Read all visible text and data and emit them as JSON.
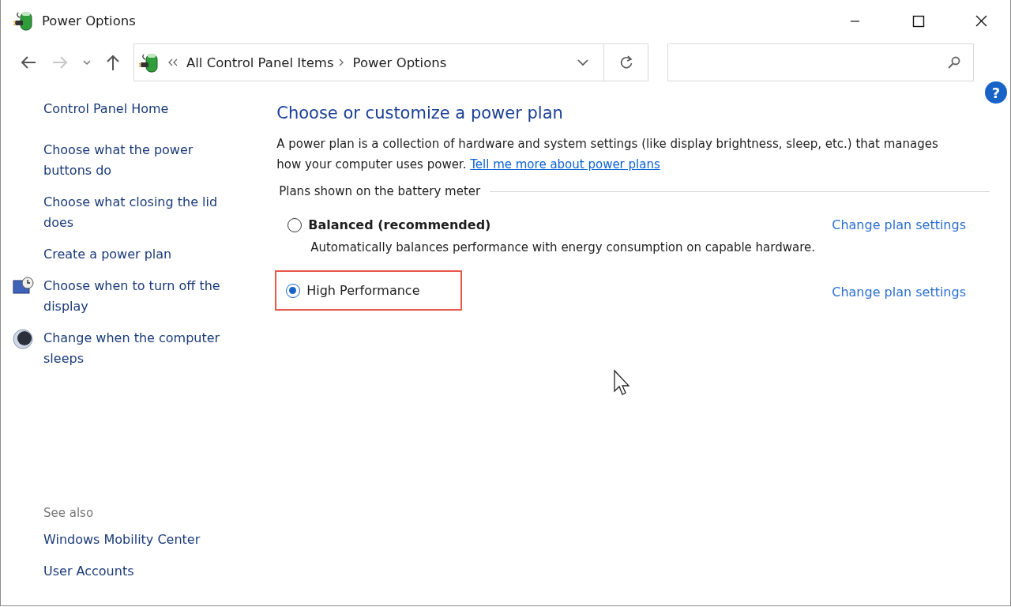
{
  "window": {
    "title": "Power Options"
  },
  "address_bar": {
    "items": [
      "All Control Panel Items",
      "Power Options"
    ]
  },
  "help": "?",
  "sidebar": {
    "home": "Control Panel Home",
    "items": [
      {
        "label": "Choose what the power buttons do",
        "kind": "plain"
      },
      {
        "label": "Choose what closing the lid does",
        "kind": "plain"
      },
      {
        "label": "Create a power plan",
        "kind": "plain"
      },
      {
        "label": "Choose when to turn off the display",
        "kind": "display"
      },
      {
        "label": "Change when the computer sleeps",
        "kind": "sleep"
      }
    ],
    "see_also": {
      "heading": "See also",
      "links": [
        "Windows Mobility Center",
        "User Accounts"
      ]
    }
  },
  "main": {
    "heading": "Choose or customize a power plan",
    "intro": "A power plan is a collection of hardware and system settings (like display brightness, sleep, etc.) that manages how your computer uses power.",
    "intro_link": "Tell me more about power plans",
    "group_label": "Plans shown on the battery meter",
    "plans": [
      {
        "name": "Balanced (recommended)",
        "bold": true,
        "selected": false,
        "highlighted": false,
        "description": "Automatically balances performance with energy consumption on capable hardware.",
        "link": "Change plan settings"
      },
      {
        "name": "High Performance",
        "bold": false,
        "selected": true,
        "highlighted": true,
        "link": "Change plan settings"
      }
    ]
  }
}
